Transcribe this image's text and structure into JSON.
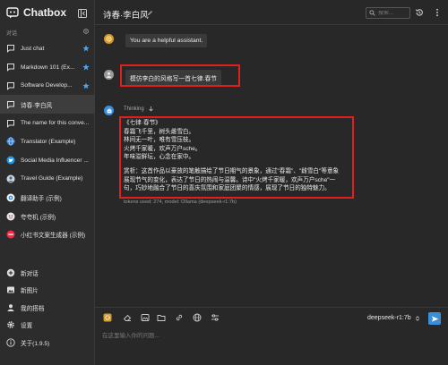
{
  "app": {
    "name": "Chatbox",
    "accent_color": "#3b8fd9",
    "highlight_color": "#e0201c"
  },
  "sidebar": {
    "section_label": "对话",
    "conversations": [
      {
        "label": "Just chat",
        "icon": "chat-bubble-icon",
        "starred": true
      },
      {
        "label": "Markdown 101 (Ex...",
        "icon": "chat-bubble-icon",
        "starred": true
      },
      {
        "label": "Software Develop...",
        "icon": "chat-bubble-icon",
        "starred": true
      },
      {
        "label": "诗春·李白风",
        "icon": "chat-bubble-icon",
        "starred": false,
        "active": true
      },
      {
        "label": "The name for this conve...",
        "icon": "chat-bubble-icon",
        "starred": false
      },
      {
        "label": "Translator (Example)",
        "icon": "globe-avatar-icon",
        "starred": false
      },
      {
        "label": "Social Media Influencer ...",
        "icon": "twitter-avatar-icon",
        "starred": false
      },
      {
        "label": "Travel Guide (Example)",
        "icon": "travel-avatar-icon",
        "starred": false
      },
      {
        "label": "翻译助手 (示例)",
        "icon": "translate-avatar-icon",
        "starred": false
      },
      {
        "label": "夸夸机 (示例)",
        "icon": "praise-avatar-icon",
        "starred": false
      },
      {
        "label": "小红书文案生成器 (示例)",
        "icon": "xiaohongshu-avatar-icon",
        "starred": false
      }
    ],
    "bottom_menu": [
      {
        "label": "新对话",
        "icon": "plus-circle-icon"
      },
      {
        "label": "新图片",
        "icon": "image-icon"
      },
      {
        "label": "我的搭档",
        "icon": "person-icon"
      },
      {
        "label": "设置",
        "icon": "gear-icon"
      },
      {
        "label": "关于(1.9.5)",
        "icon": "info-icon"
      }
    ]
  },
  "header": {
    "title": "诗春·李白风",
    "search_placeholder": "搜索..."
  },
  "messages": {
    "system": "You are a helpful assistant.",
    "user": "模仿李白的风格写一首七律.春节",
    "thinking_label": "Thinking",
    "assistant_lines": [
      "《七律·春节》",
      "春霜飞千里，树头雌雪白。",
      "林间无一叶，唯有雪压枝。",
      "火烤千家暖，欢声万户sche。",
      "年味溢鲜坛，心念在家中。",
      "",
      "赏析：这首作品以豪放的笔触描绘了节日期气的景象，通过\"春霜\"、\"雌雪白\"等意象展现节气的变化，表达了节日的热闹与温馨。诗中\"火烤千家暖，欢声万户sche\"一句，巧妙地融合了节日的喜庆氛围和家庭团聚的情感，展现了节日的独特魅力。"
    ],
    "meta": "tokens used: 274, model: Ollama (deepseek-r1:7b)"
  },
  "composer": {
    "model": "deepseek-r1:7b",
    "placeholder": "在这里输入你的问题..."
  }
}
